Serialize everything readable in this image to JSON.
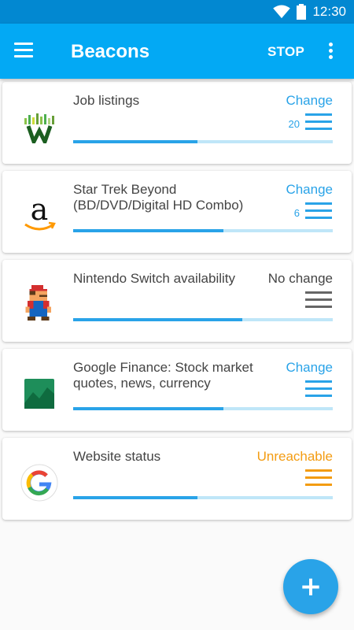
{
  "status_bar": {
    "time": "12:30"
  },
  "app_bar": {
    "title": "Beacons",
    "action": "STOP"
  },
  "beacons": [
    {
      "name": "Job listings",
      "status": "Change",
      "status_kind": "change",
      "count": "20",
      "progress": 0.48,
      "logo": "w-icon"
    },
    {
      "name": "Star Trek Beyond (BD/DVD/Digital HD Combo)",
      "status": "Change",
      "status_kind": "change",
      "count": "6",
      "progress": 0.58,
      "logo": "amazon-icon"
    },
    {
      "name": "Nintendo Switch availability",
      "status": "No change",
      "status_kind": "none",
      "count": "",
      "progress": 0.65,
      "logo": "mario-icon"
    },
    {
      "name": "Google Finance: Stock market quotes, news, currency",
      "status": "Change",
      "status_kind": "change",
      "count": "",
      "progress": 0.58,
      "logo": "finance-icon"
    },
    {
      "name": "Website status",
      "status": "Unreachable",
      "status_kind": "warn",
      "count": "",
      "progress": 0.48,
      "logo": "google-icon"
    }
  ],
  "fab": {
    "label": "+"
  },
  "colors": {
    "primary": "#03a9f4",
    "primary_dark": "#0288d1",
    "accent": "#29a3e8",
    "warning": "#f39c12"
  }
}
